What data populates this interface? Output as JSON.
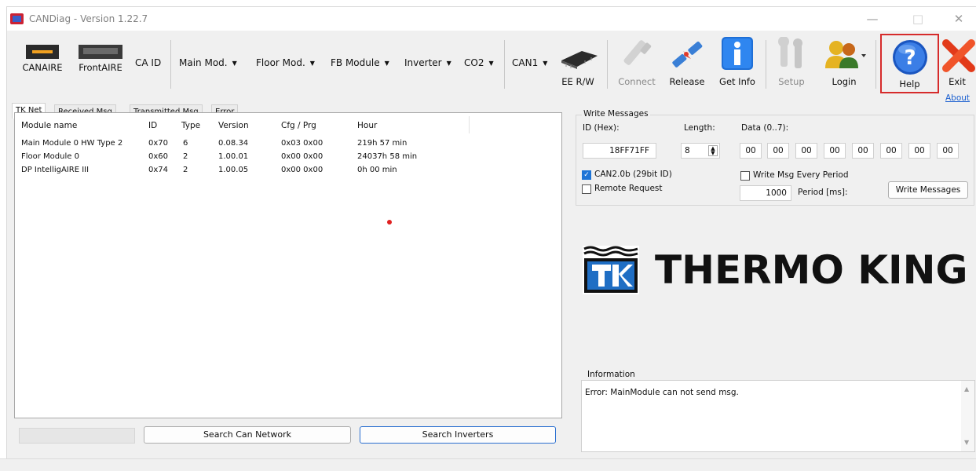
{
  "window": {
    "title": "CANDiag - Version 1.22.7",
    "controls": {
      "minimize": "—",
      "maximize": "□",
      "close": "✕"
    }
  },
  "toolbar": {
    "canaire_label": "CANAIRE",
    "frontaire_label": "FrontAIRE",
    "caid_label": "CA ID",
    "menus": [
      "Main Mod.",
      "Floor Mod.",
      "FB Module",
      "Inverter",
      "CO2",
      "CAN1"
    ],
    "eerw_label": "EE R/W",
    "connect_label": "Connect",
    "release_label": "Release",
    "getinfo_label": "Get Info",
    "setup_label": "Setup",
    "login_label": "Login",
    "help_label": "Help",
    "exit_label": "Exit",
    "about_label": "About",
    "accent_red": "#d62b2b",
    "link_blue": "#1a5fd0"
  },
  "tabs": [
    "TK Net",
    "Received Msg",
    "Transmitted Msg",
    "Error"
  ],
  "modules_table": {
    "columns": [
      "Module name",
      "ID",
      "Type",
      "Version",
      "Cfg / Prg",
      "Hour"
    ],
    "rows": [
      [
        "Main Module 0 HW Type 2",
        "0x70",
        "6",
        "0.08.34",
        "0x03 0x00",
        "219h 57 min"
      ],
      [
        "Floor Module 0",
        "0x60",
        "2",
        "1.00.01",
        "0x00 0x00",
        "24037h 58 min"
      ],
      [
        "DP IntelligAIRE III",
        "0x74",
        "2",
        "1.00.05",
        "0x00 0x00",
        "0h 00 min"
      ]
    ]
  },
  "bottom": {
    "search_can_label": "Search Can Network",
    "search_inverters_label": "Search Inverters"
  },
  "write_messages": {
    "title": "Write Messages",
    "id_label": "ID (Hex):",
    "id_value": "18FF71FF",
    "length_label": "Length:",
    "length_value": "8",
    "data_label": "Data (0..7):",
    "data_bytes": [
      "00",
      "00",
      "00",
      "00",
      "00",
      "00",
      "00",
      "00"
    ],
    "can20b_label": "CAN2.0b (29bit ID)",
    "can20b_checked": true,
    "remote_label": "Remote Request",
    "remote_checked": false,
    "every_period_label": "Write Msg Every Period",
    "every_period_checked": false,
    "period_value": "1000",
    "period_label": "Period [ms]:",
    "write_button_label": "Write Messages"
  },
  "logo": {
    "text": "THERMO KING",
    "brand_blue": "#1f6ec4"
  },
  "information": {
    "title": "Information",
    "message": "Error: MainModule can not send msg."
  }
}
